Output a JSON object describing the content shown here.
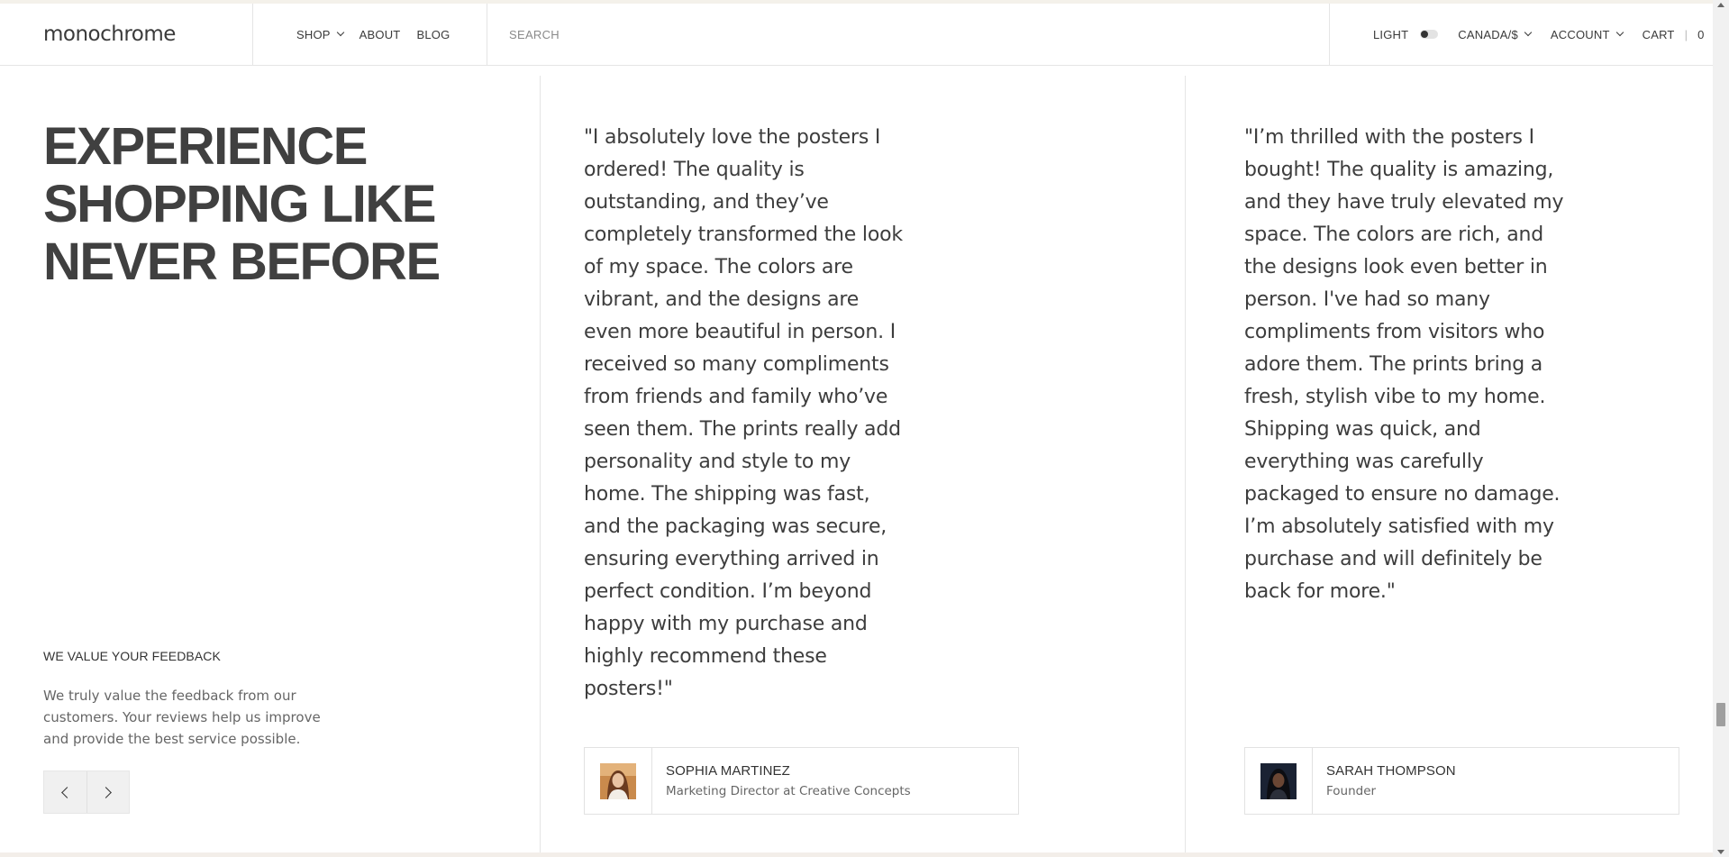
{
  "header": {
    "logo": "monochrome",
    "nav": [
      {
        "label": "SHOP",
        "has_dropdown": true
      },
      {
        "label": "ABOUT",
        "has_dropdown": false
      },
      {
        "label": "BLOG",
        "has_dropdown": false
      }
    ],
    "search": {
      "placeholder": "SEARCH",
      "value": ""
    },
    "theme_toggle_label": "LIGHT",
    "currency_label": "CANADA/$",
    "account_label": "ACCOUNT",
    "cart_label": "CART",
    "cart_count": "0"
  },
  "intro": {
    "headline": "EXPERIENCE SHOPPING LIKE NEVER BEFORE",
    "feedback_title": "WE VALUE YOUR FEEDBACK",
    "feedback_text": "We truly value the feedback from our customers. Your reviews help us improve and provide the best service possible."
  },
  "reviews": [
    {
      "quote": "\"I absolutely love the posters I ordered! The quality is outstanding, and they’ve completely transformed the look of my space. The colors are vibrant, and the designs are even more beautiful in person. I received so many compliments from friends and family who’ve seen them. The prints really add personality and style to my home. The shipping was fast, and the packaging was secure, ensuring everything arrived in perfect condition. I’m beyond happy with my purchase and highly recommend these posters!\"",
      "name": "SOPHIA MARTINEZ",
      "role": "Marketing Director at Creative Concepts"
    },
    {
      "quote": "\"I’m thrilled with the posters I bought! The quality is amazing, and they have truly elevated my space. The colors are rich, and the designs look even better in person. I've had so many compliments from visitors who adore them. The prints bring a fresh, stylish vibe to my home. Shipping was quick, and everything was carefully packaged to ensure no damage. I’m absolutely satisfied with my purchase and will definitely be back for more.\"",
      "name": "SARAH THOMPSON",
      "role": "Founder"
    }
  ],
  "colors": {
    "text_primary": "#3d3d3d",
    "text_muted": "#666666",
    "border": "#e5e5e5",
    "arrow_bg": "#f0f0f0"
  }
}
